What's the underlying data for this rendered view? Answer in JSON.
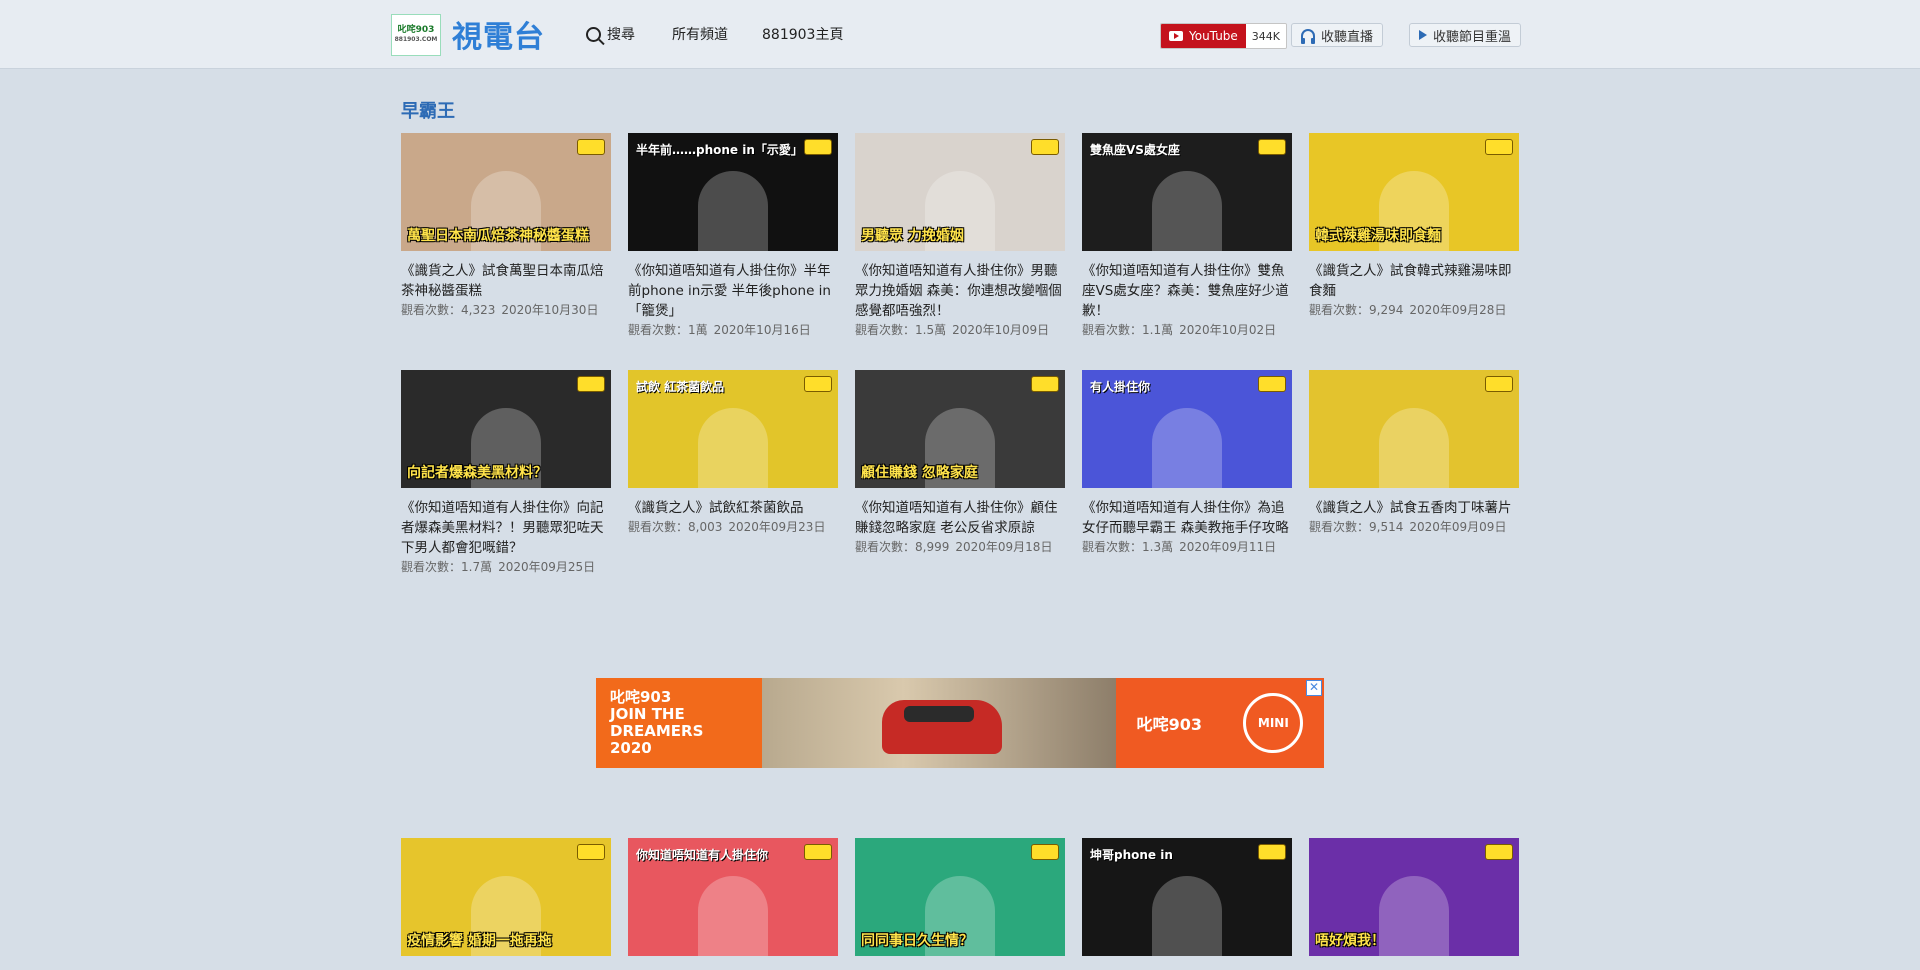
{
  "header": {
    "logo_box_text": "叱咤903",
    "logo_box_sub": "881903.COM",
    "site_title": "視電台",
    "search_label": "搜尋",
    "all_channels": "所有頻道",
    "home_label": "881903主頁",
    "youtube_label": "YouTube",
    "youtube_count": "344K",
    "listen_live": "收聽直播",
    "listen_replay": "收聽節目重溫"
  },
  "section": {
    "title": "早霸王"
  },
  "videos_row1": [
    {
      "title": "《識貨之人》試食萬聖日本南瓜焙茶神秘醬蛋糕",
      "views": "觀看次數：4,323",
      "date": "2020年10月30日",
      "thumb_caption": "萬聖日本南瓜焙茶神秘醬蛋糕",
      "thumb_bg": "#c9a88a"
    },
    {
      "title": "《你知道唔知道有人掛住你》半年前phone in示愛 半年後phone in「籠煲」",
      "views": "觀看次數：1萬",
      "date": "2020年10月16日",
      "thumb_caption": "半年前……phone in「示愛」",
      "thumb_bg": "#111111"
    },
    {
      "title": "《你知道唔知道有人掛住你》男聽眾力挽婚姻 森美：你連想改變嗰個感覺都唔強烈！",
      "views": "觀看次數：1.5萬",
      "date": "2020年10月09日",
      "thumb_caption": "男聽眾 力挽婚姻",
      "thumb_bg": "#d9d3cd"
    },
    {
      "title": "《你知道唔知道有人掛住你》雙魚座VS處女座？森美：雙魚座好少道歉！",
      "views": "觀看次數：1.1萬",
      "date": "2020年10月02日",
      "thumb_caption": "雙魚座VS處女座",
      "thumb_bg": "#1d1d1d"
    },
    {
      "title": "《識貨之人》試食韓式辣雞湯味即食麵",
      "views": "觀看次數：9,294",
      "date": "2020年09月28日",
      "thumb_caption": "韓式辣雞湯味即食麵",
      "thumb_bg": "#e8c626"
    }
  ],
  "videos_row2": [
    {
      "title": "《你知道唔知道有人掛住你》向記者爆森美黑材料？！男聽眾犯咗天下男人都會犯嘅錯？",
      "views": "觀看次數：1.7萬",
      "date": "2020年09月25日",
      "thumb_caption": "向記者爆森美黑材料？",
      "thumb_bg": "#2a2a2a"
    },
    {
      "title": "《識貨之人》試飲紅茶菌飲品",
      "views": "觀看次數：8,003",
      "date": "2020年09月23日",
      "thumb_caption": "試飲 紅茶菌飲品",
      "thumb_bg": "#e2c52a"
    },
    {
      "title": "《你知道唔知道有人掛住你》顧住賺錢忽略家庭 老公反省求原諒",
      "views": "觀看次數：8,999",
      "date": "2020年09月18日",
      "thumb_caption": "顧住賺錢 忽略家庭",
      "thumb_bg": "#3a3a3a"
    },
    {
      "title": "《你知道唔知道有人掛住你》為追女仔而聽早霸王 森美教拖手仔攻略",
      "views": "觀看次數：1.3萬",
      "date": "2020年09月11日",
      "thumb_caption": "有人掛住你",
      "thumb_bg": "#4b55d8"
    },
    {
      "title": "《識貨之人》試食五香肉丁味薯片",
      "views": "觀看次數：9,514",
      "date": "2020年09月09日",
      "thumb_caption": "",
      "thumb_bg": "#e3c32e"
    }
  ],
  "videos_row3": [
    {
      "thumb_caption": "疫情影響 婚期一拖再拖",
      "thumb_bg": "#e6c52c"
    },
    {
      "thumb_caption": "你知道唔知道有人掛住你",
      "thumb_bg": "#e8575f"
    },
    {
      "thumb_caption": "同同事日久生情？",
      "thumb_bg": "#2ba87c"
    },
    {
      "thumb_caption": "坤哥phone in",
      "thumb_bg": "#161616"
    },
    {
      "thumb_caption": "唔好煩我！",
      "thumb_bg": "#6b2fa8"
    }
  ],
  "ad": {
    "left_text_1": "叱咤903",
    "left_text_2": "JOIN THE",
    "left_text_3": "DREAMERS",
    "left_text_4": "2020",
    "right_logo_1": "叱咤903",
    "right_logo_2": "MINI",
    "close": "✕"
  }
}
